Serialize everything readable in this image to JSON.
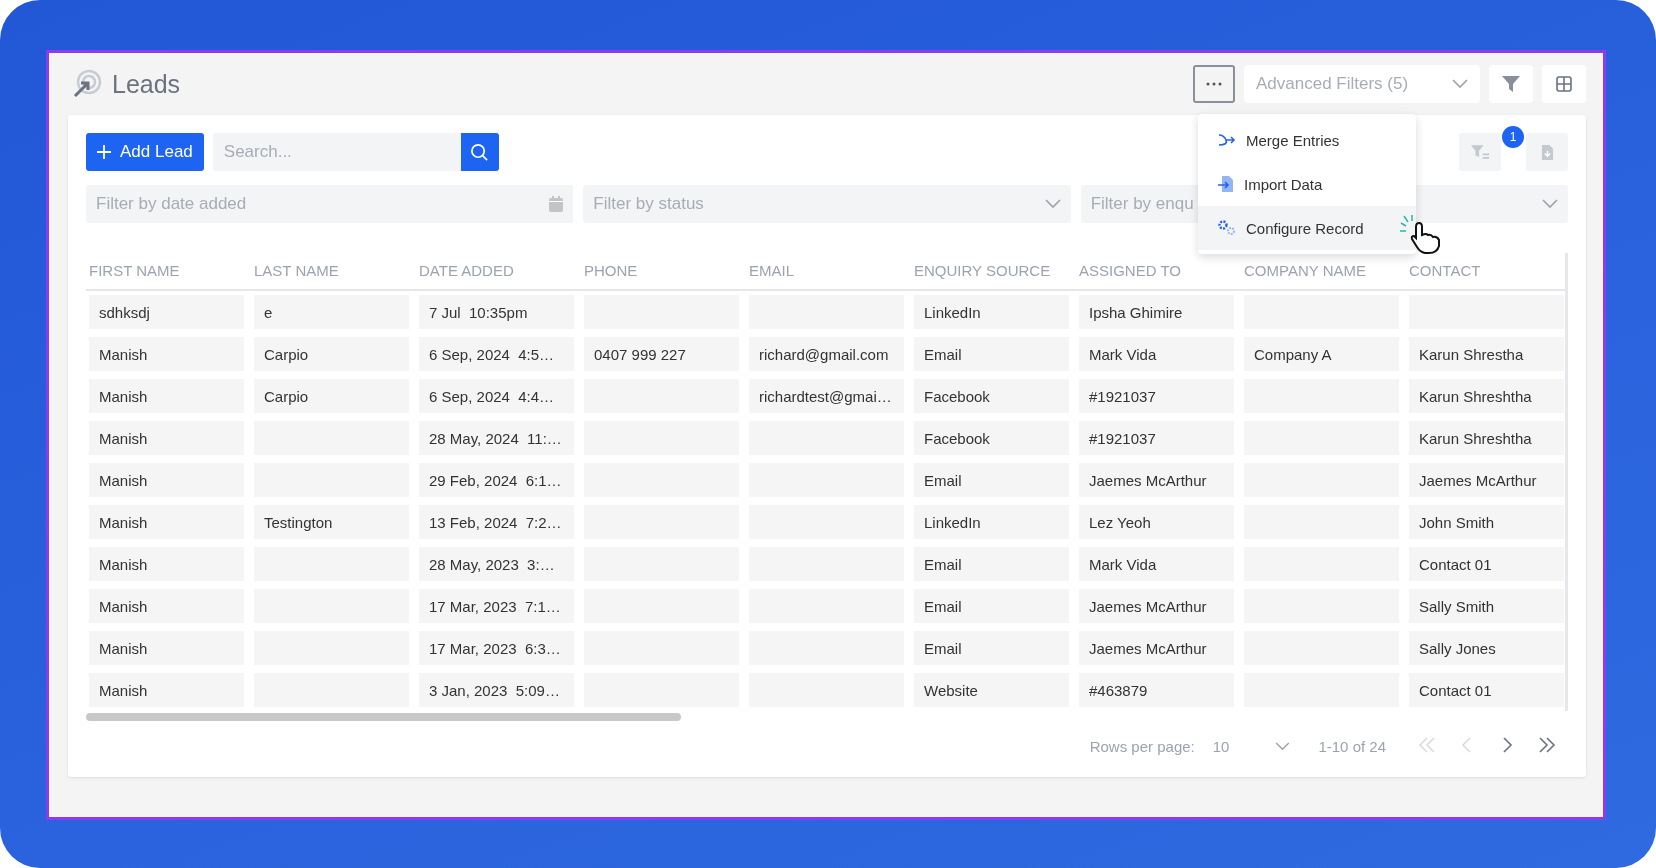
{
  "page": {
    "title": "Leads"
  },
  "header_actions": {
    "more": {
      "expanded": true
    },
    "advanced_filters": {
      "placeholder": "Advanced Filters (5)"
    }
  },
  "menu": {
    "items": [
      {
        "kind": "merge",
        "label": "Merge Entries",
        "selected": false
      },
      {
        "kind": "import",
        "label": "Import Data",
        "selected": false
      },
      {
        "kind": "configure",
        "label": "Configure Record",
        "selected": true
      }
    ]
  },
  "toolbar": {
    "add_button": "Add Lead",
    "search": {
      "placeholder": "Search..."
    },
    "filter_badge": "1"
  },
  "filters": [
    {
      "kind": "date",
      "placeholder": "Filter by date added"
    },
    {
      "kind": "select",
      "placeholder": "Filter by status"
    },
    {
      "kind": "select",
      "placeholder": "Filter by enqu"
    }
  ],
  "table": {
    "columns": [
      "FIRST NAME",
      "LAST NAME",
      "DATE ADDED",
      "PHONE",
      "EMAIL",
      "ENQUIRY SOURCE",
      "ASSIGNED TO",
      "COMPANY NAME",
      "CONTACT"
    ],
    "rows": [
      [
        "sdhksdj",
        "e",
        "7 Jul  10:35pm",
        null,
        null,
        "LinkedIn",
        "Ipsha Ghimire",
        null,
        null
      ],
      [
        "Manish",
        "Carpio",
        "6 Sep, 2024  4:5…",
        "0407 999 227",
        "richard@gmail.com",
        "Email",
        "Mark Vida",
        "Company A",
        "Karun Shrestha"
      ],
      [
        "Manish",
        "Carpio",
        "6 Sep, 2024  4:4…",
        null,
        "richardtest@gmai…",
        "Facebook",
        "#1921037",
        null,
        "Karun Shreshtha"
      ],
      [
        "Manish",
        null,
        "28 May, 2024  11:…",
        null,
        null,
        "Facebook",
        "#1921037",
        null,
        "Karun Shreshtha"
      ],
      [
        "Manish",
        null,
        "29 Feb, 2024  6:1…",
        null,
        null,
        "Email",
        "Jaemes McArthur",
        null,
        "Jaemes McArthur"
      ],
      [
        "Manish",
        "Testington",
        "13 Feb, 2024  7:2…",
        null,
        null,
        "LinkedIn",
        "Lez Yeoh",
        null,
        "John Smith"
      ],
      [
        "Manish",
        null,
        "28 May, 2023  3:…",
        null,
        null,
        "Email",
        "Mark Vida",
        null,
        "Contact 01"
      ],
      [
        "Manish",
        null,
        "17 Mar, 2023  7:1…",
        null,
        null,
        "Email",
        "Jaemes McArthur",
        null,
        "Sally Smith"
      ],
      [
        "Manish",
        null,
        "17 Mar, 2023  6:3…",
        null,
        null,
        "Email",
        "Jaemes McArthur",
        null,
        "Sally Jones"
      ],
      [
        "Manish",
        null,
        "3 Jan, 2023  5:09…",
        null,
        null,
        "Website",
        "#463879",
        null,
        "Contact 01"
      ]
    ]
  },
  "pagination": {
    "rows_per_page_label": "Rows per page:",
    "rows_per_page": "10",
    "range": "1-10 of 24",
    "buttons": [
      {
        "kind": "first",
        "disabled": true
      },
      {
        "kind": "prev",
        "disabled": true
      },
      {
        "kind": "next",
        "disabled": false
      },
      {
        "kind": "last",
        "disabled": false
      }
    ]
  }
}
